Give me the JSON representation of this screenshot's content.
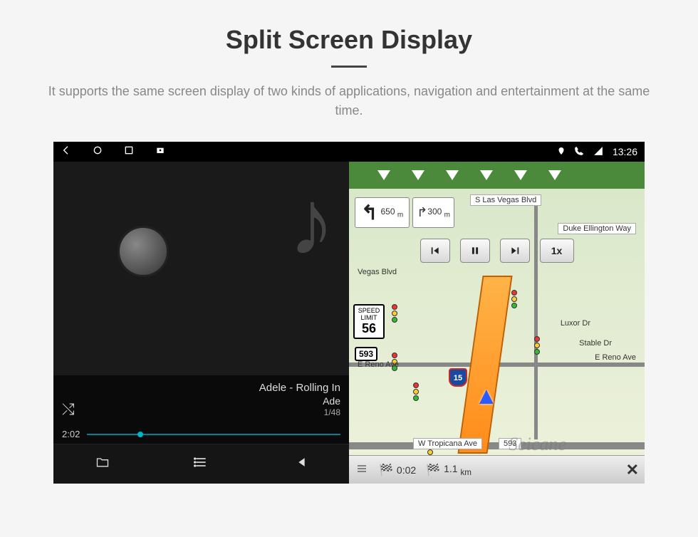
{
  "page": {
    "title": "Split Screen Display",
    "subtitle": "It supports the same screen display of two kinds of applications, navigation and entertainment at the same time."
  },
  "status": {
    "time": "13:26"
  },
  "music": {
    "track_title": "Adele - Rolling In",
    "artist": "Ade",
    "index": "1/48",
    "elapsed": "2:02"
  },
  "nav": {
    "turn_distance": "650",
    "turn_unit": "m",
    "next_turn_distance": "300",
    "next_turn_unit": "m",
    "speed_label": "SPEED LIMIT",
    "speed_value": "56",
    "interstate": "15",
    "highway": "593",
    "street_top": "S Las Vegas Blvd",
    "street_r1": "Duke Ellington Way",
    "street_r2": "Luxor Dr",
    "street_r3": "E Reno Ave",
    "street_r4": "Stable Dr",
    "street_l1": "Vegas Blvd",
    "street_l2": "E Reno Ave",
    "street_bottom": "W Tropicana Ave",
    "street_num": "593",
    "playback_speed": "1x",
    "time_est": "0:02",
    "dist_est": "1.1",
    "dist_unit": "km",
    "watermark": "Seicane"
  }
}
